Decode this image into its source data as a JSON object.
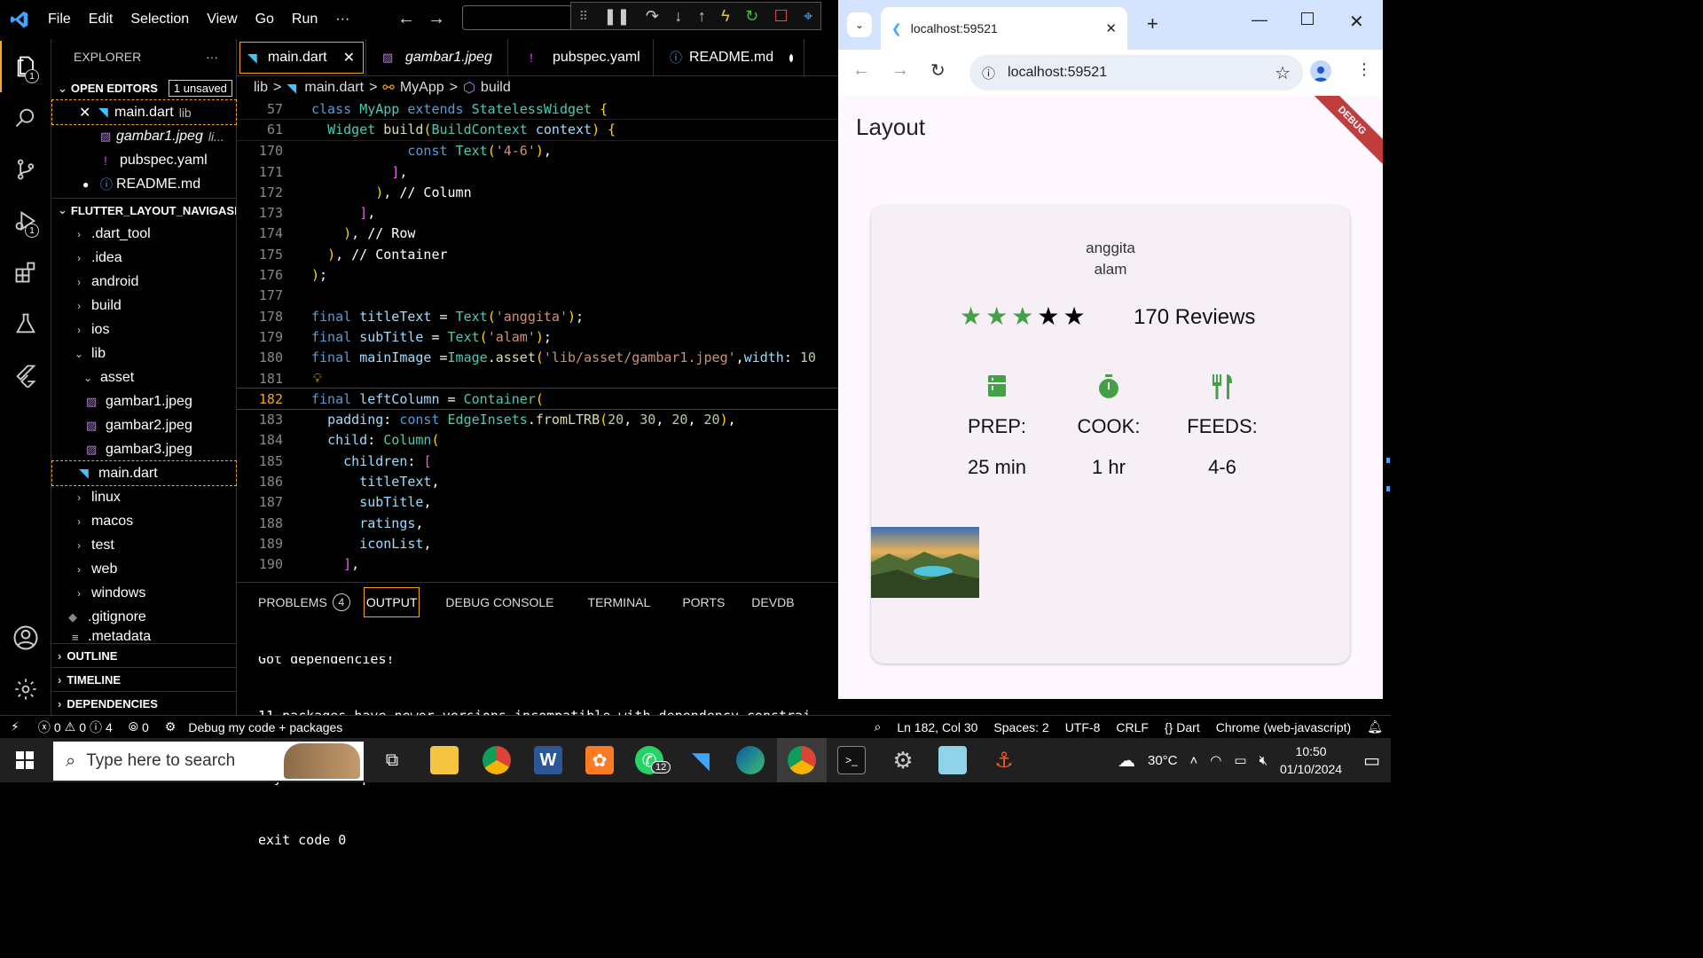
{
  "menu": [
    "File",
    "Edit",
    "Selection",
    "View",
    "Go",
    "Run",
    "···"
  ],
  "explorer": {
    "title": "EXPLORER",
    "more": "···",
    "open_editors": {
      "label": "OPEN EDITORS",
      "badge": "1 unsaved",
      "items": [
        {
          "name": "main.dart",
          "desc": "lib"
        },
        {
          "name": "gambar1.jpeg",
          "desc": "li..."
        },
        {
          "name": "pubspec.yaml",
          "desc": ""
        },
        {
          "name": "README.md",
          "desc": ""
        }
      ]
    },
    "project": {
      "label": "FLUTTER_LAYOUT_NAVIGASI",
      "items": [
        ".dart_tool",
        ".idea",
        "android",
        "build",
        "ios",
        "lib",
        "asset",
        "gambar1.jpeg",
        "gambar2.jpeg",
        "gambar3.jpeg",
        "main.dart",
        "linux",
        "macos",
        "test",
        "web",
        "windows",
        ".gitignore",
        ".metadata"
      ]
    },
    "bottom_sections": [
      "OUTLINE",
      "TIMELINE",
      "DEPENDENCIES"
    ]
  },
  "tabs": [
    {
      "label": "main.dart",
      "state": "active"
    },
    {
      "label": "gambar1.jpeg",
      "state": "preview"
    },
    {
      "label": "pubspec.yaml",
      "state": ""
    },
    {
      "label": "README.md",
      "state": "dirty"
    }
  ],
  "breadcrumb": [
    "lib",
    ">",
    "main.dart",
    ">",
    "MyApp",
    ">",
    "build"
  ],
  "editor": {
    "current_line": "182",
    "lines": [
      {
        "n": "57",
        "text": "class MyApp extends StatelessWidget {"
      },
      {
        "n": "61",
        "text": "  Widget build(BuildContext context) {"
      },
      {
        "n": "170",
        "text": "const Text('4-6'),"
      },
      {
        "n": "171",
        "text": "],"
      },
      {
        "n": "172",
        "text": "), // Column"
      },
      {
        "n": "173",
        "text": "],"
      },
      {
        "n": "174",
        "text": "), // Row"
      },
      {
        "n": "175",
        "text": "), // Container"
      },
      {
        "n": "176",
        "text": ");"
      },
      {
        "n": "177",
        "text": ""
      },
      {
        "n": "178",
        "text": "final titleText = Text('anggita');"
      },
      {
        "n": "179",
        "text": "final subTitle = Text('alam');"
      },
      {
        "n": "180",
        "text": "final mainImage =Image.asset('lib/asset/gambar1.jpeg',width: 10"
      },
      {
        "n": "181",
        "text": ""
      },
      {
        "n": "182",
        "text": "final leftColumn = Container("
      },
      {
        "n": "183",
        "text": "  padding: const EdgeInsets.fromLTRB(20, 30, 20, 20),"
      },
      {
        "n": "184",
        "text": "  child: Column("
      },
      {
        "n": "185",
        "text": "    children: ["
      },
      {
        "n": "186",
        "text": "      titleText,"
      },
      {
        "n": "187",
        "text": "      subTitle,"
      },
      {
        "n": "188",
        "text": "      ratings,"
      },
      {
        "n": "189",
        "text": "      iconList,"
      },
      {
        "n": "190",
        "text": "    ],"
      }
    ]
  },
  "panel": {
    "tabs": [
      "PROBLEMS",
      "OUTPUT",
      "DEBUG CONSOLE",
      "TERMINAL",
      "PORTS",
      "DEVDB"
    ],
    "problems_count": "4",
    "output_lines": [
      "Got dependencies!",
      "11 packages have newer versions incompatible with dependency constrai",
      "Try `flutter pub outdated` for more information.",
      "exit code 0"
    ]
  },
  "statusbar": {
    "errors": "0",
    "warnings": "0",
    "infos": "4",
    "ports": "0",
    "debug_mode": "Debug my code + packages",
    "position": "Ln 182, Col 30",
    "spaces": "Spaces: 2",
    "encoding": "UTF-8",
    "eol": "CRLF",
    "language": "Dart",
    "device": "Chrome (web-javascript)"
  },
  "chrome": {
    "tab_title": "localhost:59521",
    "url": "localhost:59521",
    "debug_banner": "DEBUG"
  },
  "app": {
    "title": "Layout",
    "title_text": "anggita",
    "subtitle": "alam",
    "rating": {
      "filled": 3,
      "total": 5
    },
    "reviews": "170 Reviews",
    "stats": [
      {
        "icon": "kitchen-icon",
        "label": "PREP:",
        "value": "25 min"
      },
      {
        "icon": "timer-icon",
        "label": "COOK:",
        "value": "1 hr"
      },
      {
        "icon": "restaurant-icon",
        "label": "FEEDS:",
        "value": "4-6"
      }
    ]
  },
  "taskbar": {
    "search_placeholder": "Type here to search",
    "whatsapp_badge": "12",
    "weather": "30°C",
    "time": "10:50",
    "date": "01/10/2024"
  },
  "colors": {
    "accent": "#f5a623",
    "flutter_green": "#43a047",
    "debug_red": "#b71c1c"
  }
}
